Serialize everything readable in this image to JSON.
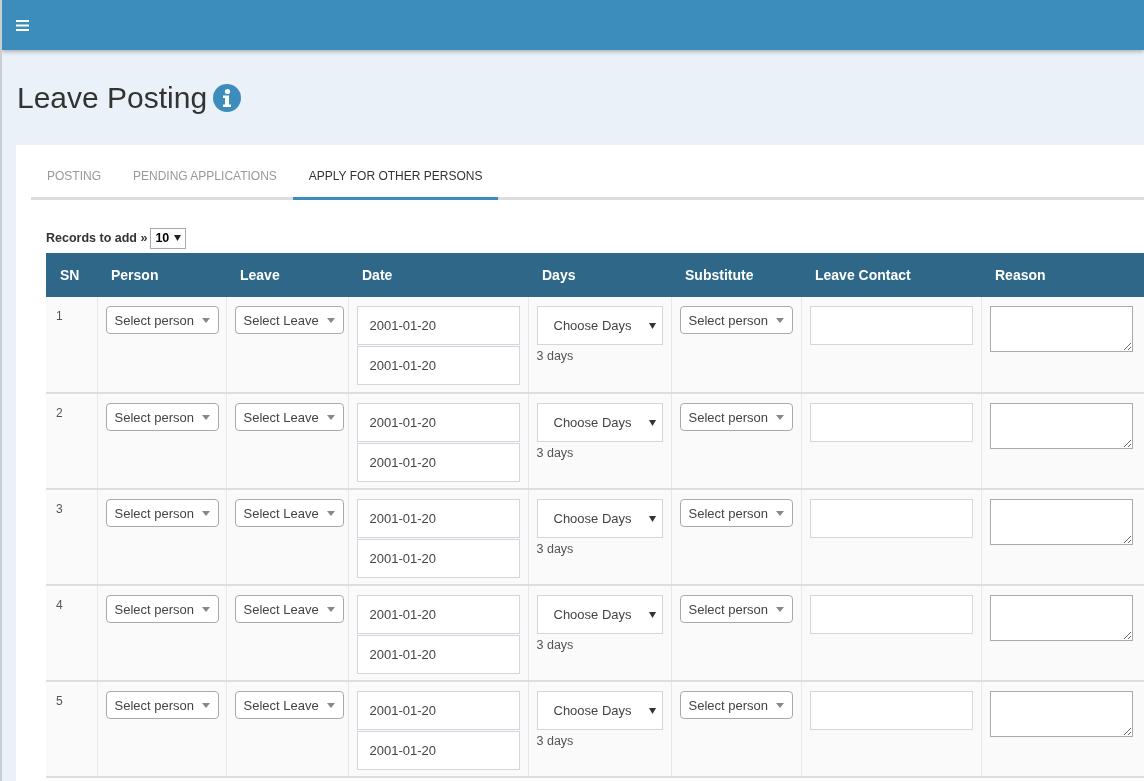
{
  "page": {
    "title": "Leave Posting"
  },
  "tabs": [
    {
      "label": "POSTING",
      "selected": false
    },
    {
      "label": "PENDING APPLICATIONS",
      "selected": false
    },
    {
      "label": "APPLY FOR OTHER PERSONS",
      "selected": true
    }
  ],
  "records_to_add": {
    "label": "Records to add »",
    "value": "10"
  },
  "table": {
    "columns": [
      "SN",
      "Person",
      "Leave",
      "Date",
      "Days",
      "Substitute",
      "Leave Contact",
      "Reason"
    ],
    "rows": [
      {
        "sn": "1",
        "person": "Select person",
        "leave": "Select Leave",
        "date_from": "2001-01-20",
        "date_to": "2001-01-20",
        "days": "Choose Days",
        "days_note": "3 days",
        "substitute": "Select person"
      },
      {
        "sn": "2",
        "person": "Select person",
        "leave": "Select Leave",
        "date_from": "2001-01-20",
        "date_to": "2001-01-20",
        "days": "Choose Days",
        "days_note": "3 days",
        "substitute": "Select person"
      },
      {
        "sn": "3",
        "person": "Select person",
        "leave": "Select Leave",
        "date_from": "2001-01-20",
        "date_to": "2001-01-20",
        "days": "Choose Days",
        "days_note": "3 days",
        "substitute": "Select person"
      },
      {
        "sn": "4",
        "person": "Select person",
        "leave": "Select Leave",
        "date_from": "2001-01-20",
        "date_to": "2001-01-20",
        "days": "Choose Days",
        "days_note": "3 days",
        "substitute": "Select person"
      },
      {
        "sn": "5",
        "person": "Select person",
        "leave": "Select Leave",
        "date_from": "2001-01-20",
        "date_to": "2001-01-20",
        "days": "Choose Days",
        "days_note": "3 days",
        "substitute": "Select person"
      }
    ]
  }
}
